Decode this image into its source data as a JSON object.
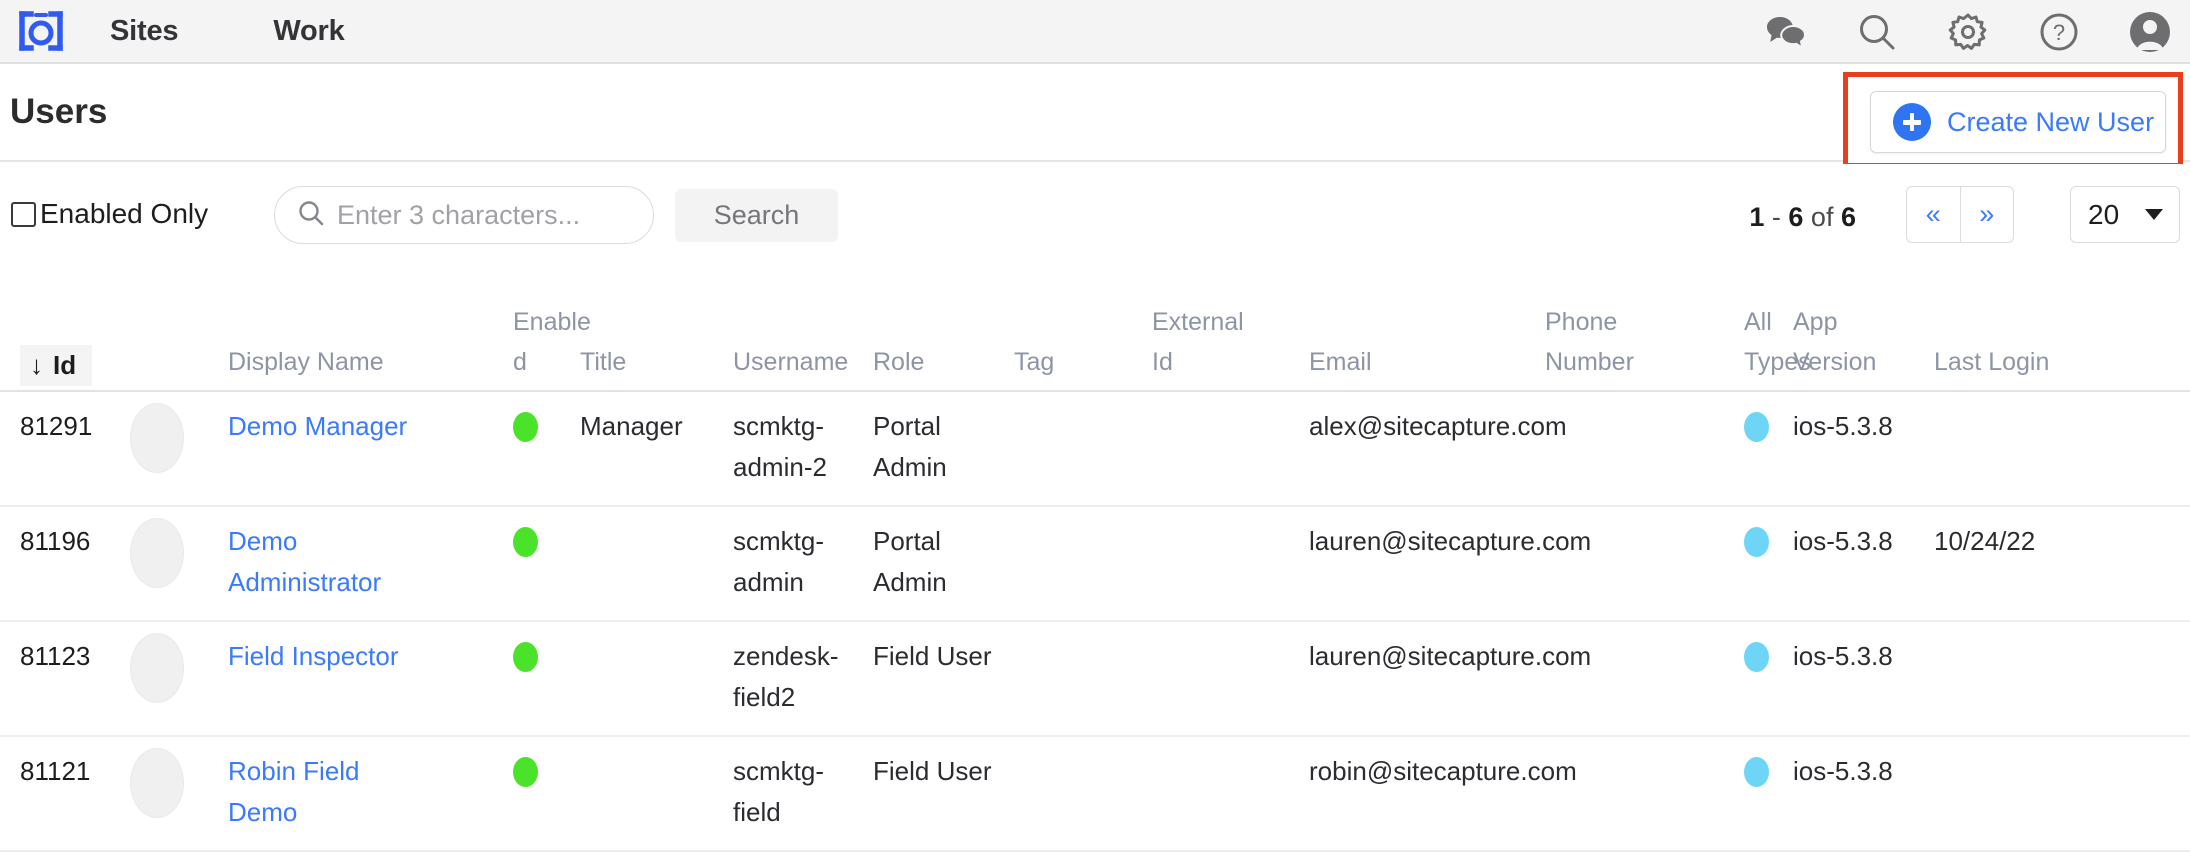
{
  "topnav": {
    "logo_icon": "camera-brackets-logo",
    "links": [
      {
        "label": "Sites",
        "name": "nav-sites"
      },
      {
        "label": "Work",
        "name": "nav-work"
      }
    ],
    "icons": [
      "chat-icon",
      "search-icon",
      "gear-icon",
      "help-icon",
      "avatar-icon"
    ]
  },
  "header": {
    "title": "Users",
    "create_button_label": "Create New User",
    "highlight_color": "#e8401f",
    "accent_color": "#3a7afe"
  },
  "filters": {
    "enabled_only_label": "Enabled Only",
    "enabled_only_checked": false,
    "search_value": "",
    "search_placeholder": "Enter 3 characters...",
    "search_button_label": "Search"
  },
  "pagination": {
    "range_start": "1",
    "range_dash": "-",
    "range_end": "6",
    "of_label": "of",
    "total": "6",
    "prev_label": "«",
    "next_label": "»",
    "page_size": "20"
  },
  "table": {
    "sort_arrow": "↓",
    "columns": [
      {
        "key": "id",
        "label": "Id",
        "sorted": true
      },
      {
        "key": "name",
        "label": "Display Name"
      },
      {
        "key": "enabled",
        "label": "Enable\nd"
      },
      {
        "key": "title",
        "label": "Title"
      },
      {
        "key": "username",
        "label": "Username"
      },
      {
        "key": "role",
        "label": "Role"
      },
      {
        "key": "tag",
        "label": "Tag"
      },
      {
        "key": "extid",
        "label": "External\nId"
      },
      {
        "key": "email",
        "label": "Email"
      },
      {
        "key": "phone",
        "label": "Phone\nNumber"
      },
      {
        "key": "types",
        "label": "All\nTypes"
      },
      {
        "key": "version",
        "label": "App\nVersion"
      },
      {
        "key": "login",
        "label": "Last Login"
      }
    ],
    "rows": [
      {
        "id": "81291",
        "name": "Demo Manager",
        "enabled": true,
        "title": "Manager",
        "username": "scmktg-admin-2",
        "role": "Portal Admin",
        "tag": "",
        "extid": "",
        "email": "alex@sitecapture.com",
        "phone": "",
        "all_types": true,
        "version": "ios-5.3.8",
        "last_login": ""
      },
      {
        "id": "81196",
        "name": "Demo Administrator",
        "enabled": true,
        "title": "",
        "username": "scmktg-admin",
        "role": "Portal Admin",
        "tag": "",
        "extid": "",
        "email": "lauren@sitecapture.com",
        "phone": "",
        "all_types": true,
        "version": "ios-5.3.8",
        "last_login": "10/24/22"
      },
      {
        "id": "81123",
        "name": "Field Inspector",
        "enabled": true,
        "title": "",
        "username": "zendesk-field2",
        "role": "Field User",
        "tag": "",
        "extid": "",
        "email": "lauren@sitecapture.com",
        "phone": "",
        "all_types": true,
        "version": "ios-5.3.8",
        "last_login": ""
      },
      {
        "id": "81121",
        "name": "Robin Field Demo",
        "enabled": true,
        "title": "",
        "username": "scmktg-field",
        "role": "Field User",
        "tag": "",
        "extid": "",
        "email": "robin@sitecapture.com",
        "phone": "",
        "all_types": true,
        "version": "ios-5.3.8",
        "last_login": ""
      }
    ],
    "status_colors": {
      "enabled": "#4be22a",
      "all_types": "#6ed5f7"
    }
  }
}
